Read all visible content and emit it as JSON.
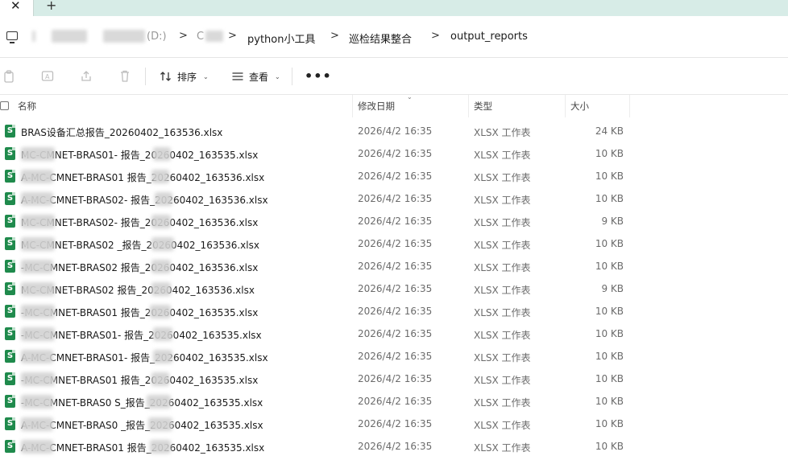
{
  "tabs": {
    "close_glyph": "✕",
    "new_glyph": "+"
  },
  "breadcrumb": {
    "items": [
      "(D:)",
      "C",
      "python小工具",
      "巡检结果整合",
      "output_reports"
    ],
    "separator": ">"
  },
  "toolbar": {
    "sort_label": "排序",
    "view_label": "查看",
    "more_label": "•••"
  },
  "columns": {
    "name": "名称",
    "modified": "修改日期",
    "type": "类型",
    "size": "大小"
  },
  "files": [
    {
      "name": "BRAS设备汇总报告_20260402_163536.xlsx",
      "date": "2026/4/2 16:35",
      "type": "XLSX 工作表",
      "size": "24 KB"
    },
    {
      "name": "MC-CMNET-BRAS01-  报告_20260402_163535.xlsx",
      "date": "2026/4/2 16:35",
      "type": "XLSX 工作表",
      "size": "10 KB"
    },
    {
      "name": "A-MC-CMNET-BRAS01  报告_20260402_163536.xlsx",
      "date": "2026/4/2 16:35",
      "type": "XLSX 工作表",
      "size": "10 KB"
    },
    {
      "name": "A-MC-CMNET-BRAS02-  报告_20260402_163536.xlsx",
      "date": "2026/4/2 16:35",
      "type": "XLSX 工作表",
      "size": "10 KB"
    },
    {
      "name": "MC-CMNET-BRAS02-  报告_20260402_163536.xlsx",
      "date": "2026/4/2 16:35",
      "type": "XLSX 工作表",
      "size": "9 KB"
    },
    {
      "name": "MC-CMNET-BRAS02  _报告_20260402_163536.xlsx",
      "date": "2026/4/2 16:35",
      "type": "XLSX 工作表",
      "size": "10 KB"
    },
    {
      "name": "-MC-CMNET-BRAS02  报告_20260402_163536.xlsx",
      "date": "2026/4/2 16:35",
      "type": "XLSX 工作表",
      "size": "10 KB"
    },
    {
      "name": "MC-CMNET-BRAS02  报告_20260402_163536.xlsx",
      "date": "2026/4/2 16:35",
      "type": "XLSX 工作表",
      "size": "9 KB"
    },
    {
      "name": "-MC-CMNET-BRAS01  报告_20260402_163535.xlsx",
      "date": "2026/4/2 16:35",
      "type": "XLSX 工作表",
      "size": "10 KB"
    },
    {
      "name": "-MC-CMNET-BRAS01-  报告_20260402_163535.xlsx",
      "date": "2026/4/2 16:35",
      "type": "XLSX 工作表",
      "size": "10 KB"
    },
    {
      "name": "A-MC-CMNET-BRAS01-  报告_20260402_163535.xlsx",
      "date": "2026/4/2 16:35",
      "type": "XLSX 工作表",
      "size": "10 KB"
    },
    {
      "name": "-MC-CMNET-BRAS01  报告_20260402_163535.xlsx",
      "date": "2026/4/2 16:35",
      "type": "XLSX 工作表",
      "size": "10 KB"
    },
    {
      "name": "-MC-CMNET-BRAS0  S_报告_20260402_163535.xlsx",
      "date": "2026/4/2 16:35",
      "type": "XLSX 工作表",
      "size": "10 KB"
    },
    {
      "name": "A-MC-CMNET-BRAS0  _报告_20260402_163535.xlsx",
      "date": "2026/4/2 16:35",
      "type": "XLSX 工作表",
      "size": "10 KB"
    },
    {
      "name": "A-MC-CMNET-BRAS01  报告_20260402_163535.xlsx",
      "date": "2026/4/2 16:35",
      "type": "XLSX 工作表",
      "size": "10 KB"
    }
  ],
  "icons": {
    "file": "excel-file-icon",
    "copy": "copy-icon",
    "rename": "rename-icon",
    "share": "share-icon",
    "delete": "delete-icon",
    "sort": "sort-icon",
    "view": "view-icon"
  }
}
